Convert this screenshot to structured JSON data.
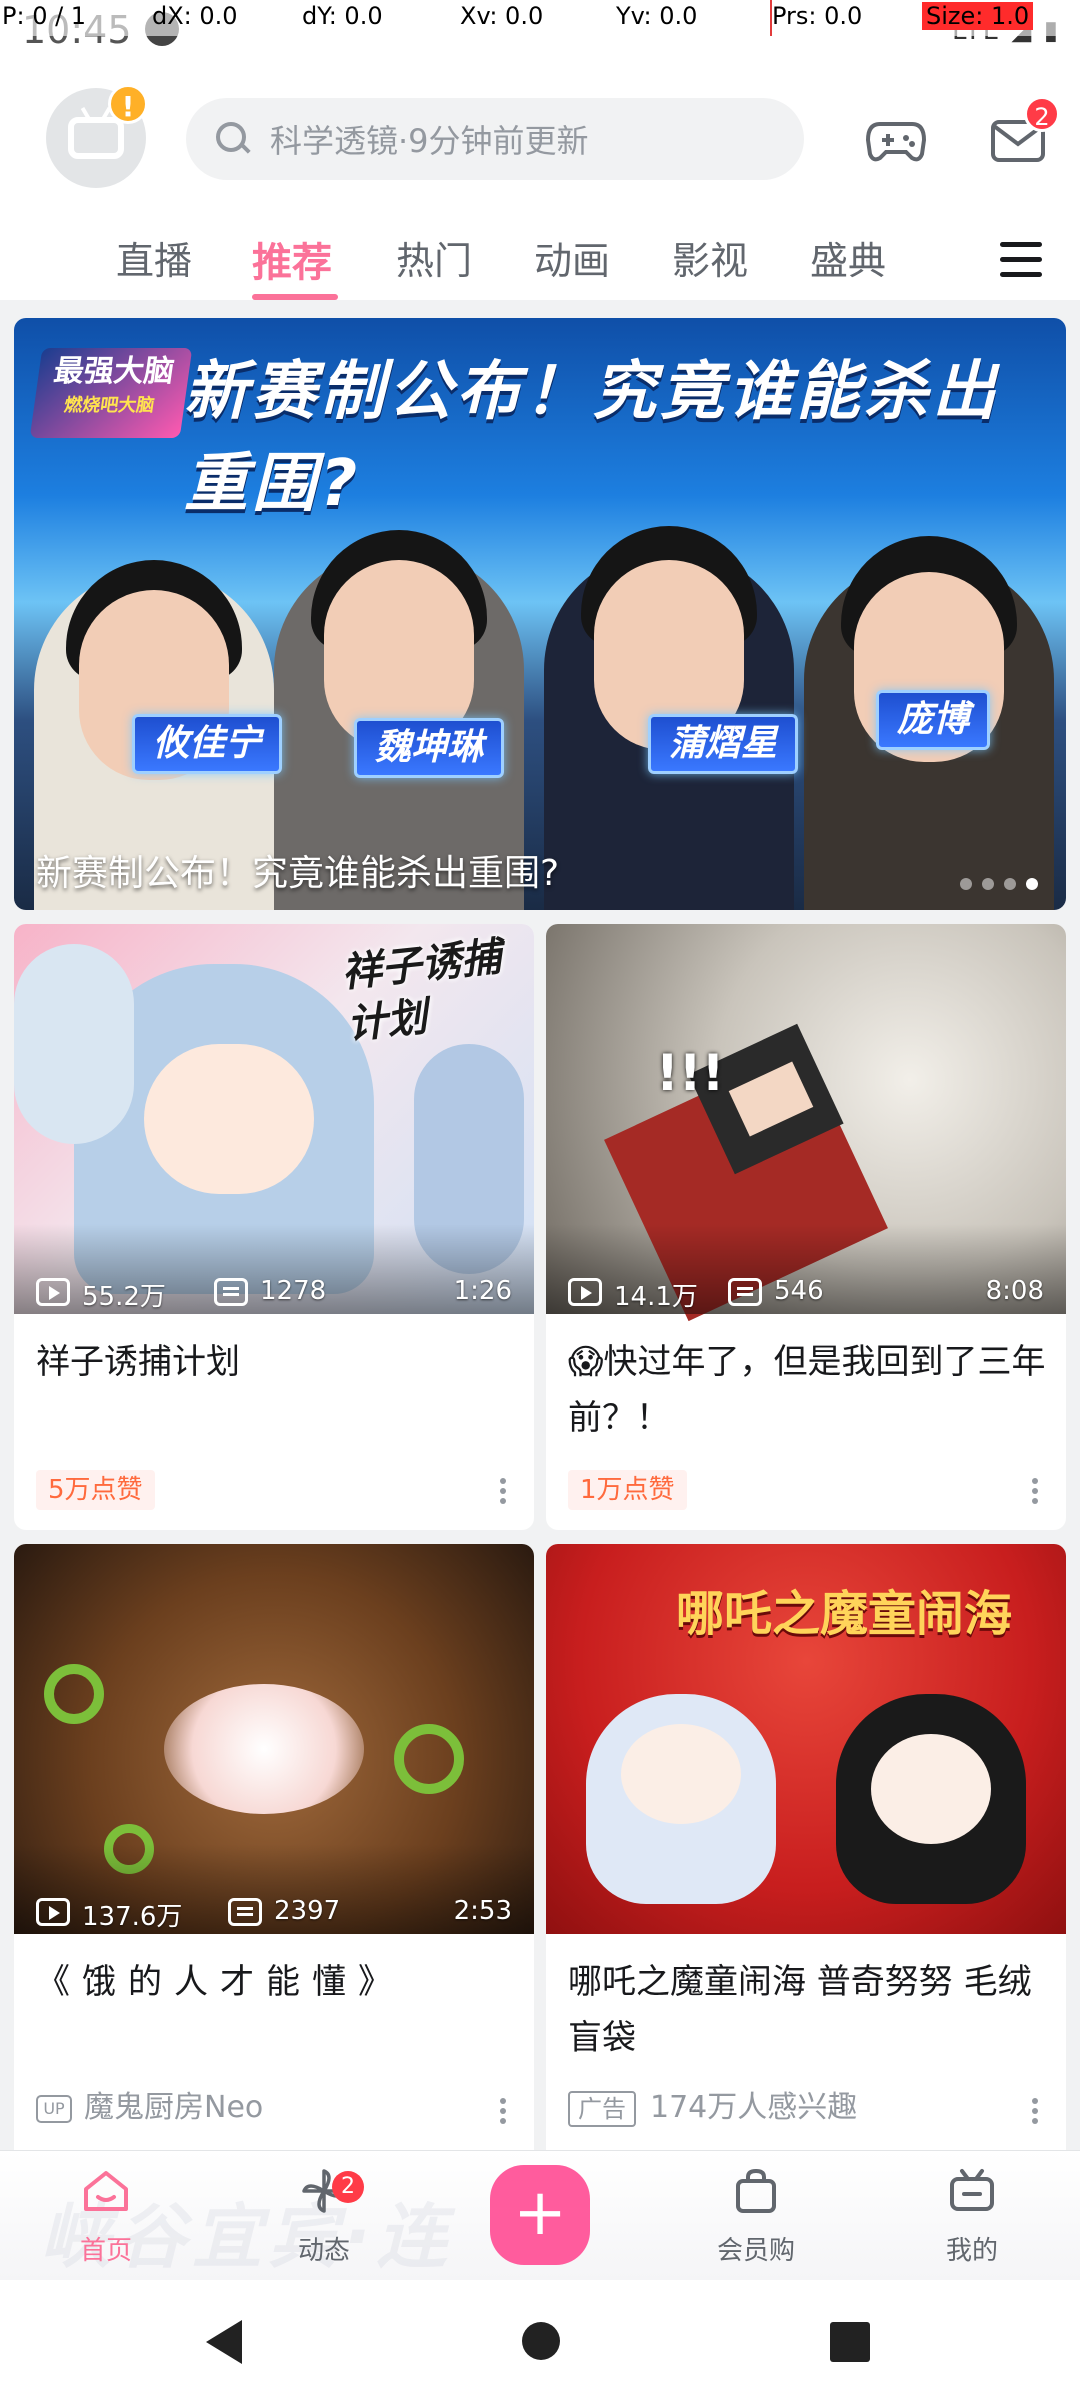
{
  "status_bar": {
    "time": "10:45",
    "right_icons": "LTE ◢ ▮"
  },
  "pointer_overlay": {
    "p": "P: 0 / 1",
    "dx": "dX: 0.0",
    "dy": "dY: 0.0",
    "xv": "Xv: 0.0",
    "yv": "Yv: 0.0",
    "prs": "Prs: 0.0",
    "size": "Size: 1.0"
  },
  "header": {
    "avatar_badge": "!",
    "search_placeholder": "科学透镜·9分钟前更新",
    "mail_badge": "2"
  },
  "tabs": [
    {
      "label": "直播",
      "active": false
    },
    {
      "label": "推荐",
      "active": true
    },
    {
      "label": "热门",
      "active": false
    },
    {
      "label": "动画",
      "active": false
    },
    {
      "label": "影视",
      "active": false
    },
    {
      "label": "盛典",
      "active": false
    }
  ],
  "banner": {
    "headline": "新赛制公布！究竟谁能杀出重围?",
    "logo_main": "最强大脑",
    "logo_sub": "燃烧吧大脑",
    "caption": "新赛制公布！究竟谁能杀出重围?",
    "names": [
      "攸佳宁",
      "魏坤琳",
      "蒲熠星",
      "庞博"
    ],
    "dot_count": 4,
    "active_dot": 3
  },
  "cards": [
    {
      "cover_text": "祥子诱捕计划",
      "views": "55.2万",
      "danmaku": "1278",
      "duration": "1:26",
      "title": "祥子诱捕计划",
      "tag": "5万点赞"
    },
    {
      "views": "14.1万",
      "danmaku": "546",
      "duration": "8:08",
      "title": "😱快过年了，但是我回到了三年前？！",
      "tag": "1万点赞"
    },
    {
      "views": "137.6万",
      "danmaku": "2397",
      "duration": "2:53",
      "title": "《饿的人才能懂》",
      "up_badge": "UP",
      "author": "魔鬼厨房Neo"
    },
    {
      "cover_text": "哪吒之魔童闹海",
      "title": "哪吒之魔童闹海 普奇努努 毛绒盲袋",
      "ad_badge": "广告",
      "interest": "174万人感兴趣"
    }
  ],
  "bottom_nav": {
    "items": [
      {
        "label": "首页",
        "icon": "home-icon",
        "active": true
      },
      {
        "label": "动态",
        "icon": "pinwheel-icon",
        "badge": "2"
      },
      {
        "label": "会员购",
        "icon": "shopping-bag-icon"
      },
      {
        "label": "我的",
        "icon": "tv-icon"
      }
    ],
    "plus": "+",
    "bg_text": "峡谷宜宾·连"
  },
  "colors": {
    "accent": "#fb7299",
    "badge_red": "#ff3b47",
    "tag_orange": "#ff6a3d"
  }
}
